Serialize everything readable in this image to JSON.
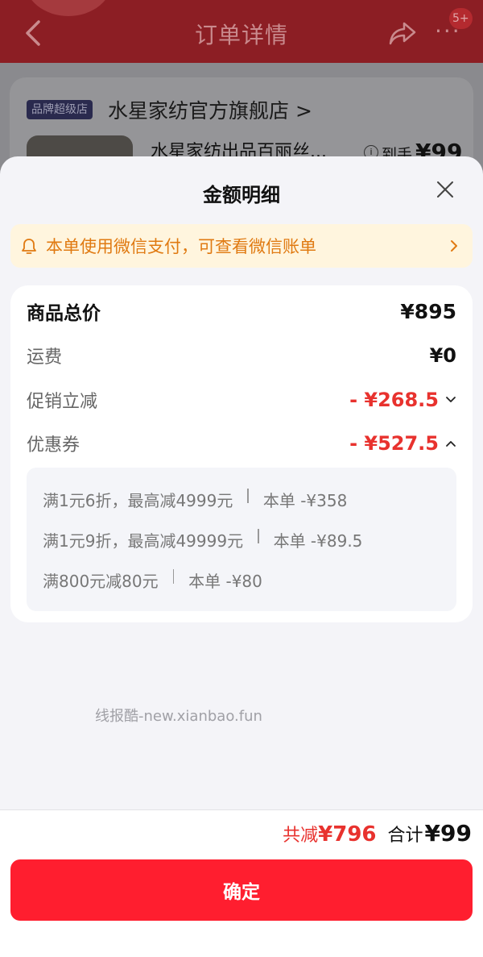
{
  "background": {
    "header_title": "订单详情",
    "badge": "5+",
    "more_glyph": "···",
    "store_tag": "品牌超级店",
    "store_name": "水星家纺官方旗舰店 >",
    "product_title": "水星家纺出品百丽丝...",
    "info_glyph": "i",
    "price_label": "到手",
    "price": "¥99"
  },
  "sheet": {
    "title": "金额明细",
    "notice": "本单使用微信支付，可查看微信账单",
    "rows": [
      {
        "label": "商品总价",
        "value": "¥895"
      },
      {
        "label": "运费",
        "value": "¥0"
      },
      {
        "label": "促销立减",
        "value": "- ¥268.5"
      },
      {
        "label": "优惠券",
        "value": "- ¥527.5"
      }
    ],
    "coupons": [
      {
        "rule": "满1元6折，最高减4999元",
        "amount": "本单 -¥358"
      },
      {
        "rule": "满1元9折，最高减49999元",
        "amount": "本单 -¥89.5"
      },
      {
        "rule": "满800元减80元",
        "amount": "本单 -¥80"
      }
    ],
    "watermark": "线报酷-new.xianbao.fun"
  },
  "footer": {
    "save_label": "共减",
    "save_value": "¥796",
    "total_label": "合计",
    "total_value": "¥99",
    "confirm_label": "确定"
  },
  "colors": {
    "accent_red": "#ff1e2f",
    "discount_red": "#e8322e",
    "notice_orange": "#e07a12",
    "notice_bg": "#fff5de"
  }
}
